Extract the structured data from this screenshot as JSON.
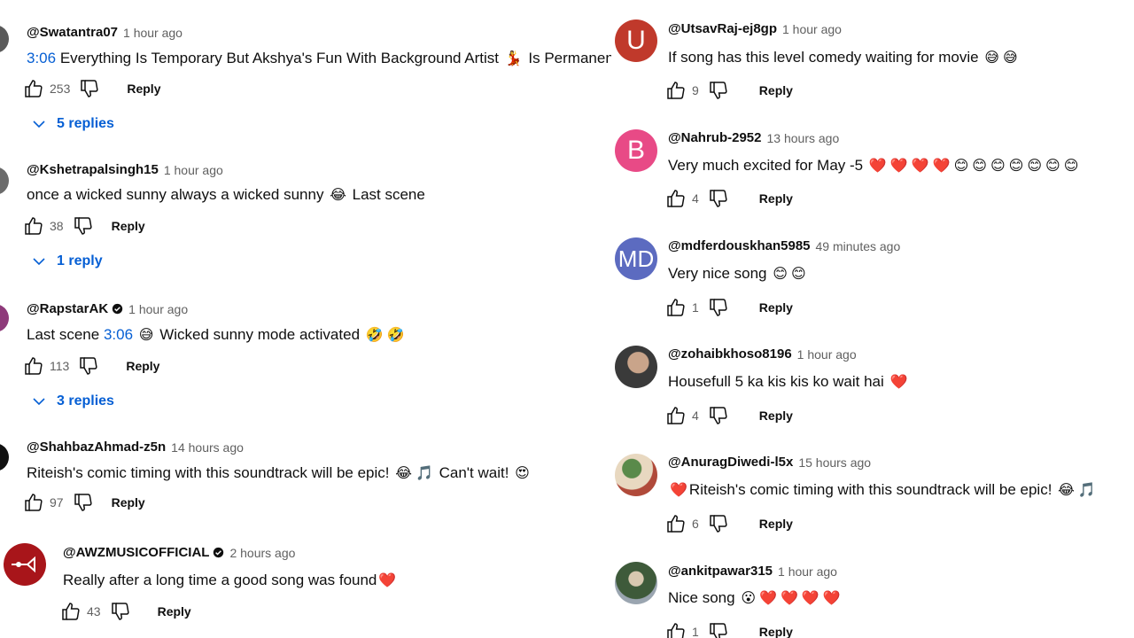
{
  "left": [
    {
      "author": "@Swatantra07",
      "time": "1 hour ago",
      "verified": false,
      "parts": [
        {
          "t": "ts",
          "v": "3:06"
        },
        {
          "t": "txt",
          "v": " Everything Is Temporary But Akshya's Fun With Background Artist "
        },
        {
          "t": "em",
          "v": "💃"
        },
        {
          "t": "txt",
          "v": " Is Permanente"
        }
      ],
      "likes": "253",
      "reply": "Reply",
      "replies": "5 replies"
    },
    {
      "author": "@Kshetrapalsingh15",
      "time": "1 hour ago",
      "verified": false,
      "parts": [
        {
          "t": "txt",
          "v": "once a wicked sunny always a wicked sunny "
        },
        {
          "t": "em",
          "v": "😂"
        },
        {
          "t": "txt",
          "v": " Last scene"
        }
      ],
      "likes": "38",
      "reply": "Reply",
      "replies": "1 reply"
    },
    {
      "author": "@RapstarAK",
      "time": "1 hour ago",
      "verified": true,
      "parts": [
        {
          "t": "txt",
          "v": "Last scene "
        },
        {
          "t": "ts",
          "v": "3:06"
        },
        {
          "t": "txt",
          "v": " "
        },
        {
          "t": "em",
          "v": "😅"
        },
        {
          "t": "txt",
          "v": "  Wicked sunny mode activated "
        },
        {
          "t": "em",
          "v": "🤣"
        },
        {
          "t": "em",
          "v": "🤣"
        }
      ],
      "likes": "113",
      "reply": "Reply",
      "replies": "3 replies"
    },
    {
      "author": "@ShahbazAhmad-z5n",
      "time": "14 hours ago",
      "verified": false,
      "parts": [
        {
          "t": "txt",
          "v": "Riteish's comic timing with this soundtrack will be epic! "
        },
        {
          "t": "em",
          "v": "😂"
        },
        {
          "t": "em",
          "v": "🎵"
        },
        {
          "t": "txt",
          "v": " Can't wait! "
        },
        {
          "t": "em",
          "v": "😍"
        }
      ],
      "likes": "97",
      "reply": "Reply",
      "replies": ""
    },
    {
      "author": "@AWZMUSICOFFICIAL",
      "time": "2 hours ago",
      "verified": true,
      "parts": [
        {
          "t": "txt",
          "v": "Really after a long time a good song was found"
        },
        {
          "t": "em",
          "v": "❤️"
        }
      ],
      "likes": "43",
      "reply": "Reply",
      "replies": ""
    }
  ],
  "right": [
    {
      "author": "@UtsavRaj-ej8gp",
      "time": "1 hour ago",
      "avatar_letter": "U",
      "avatar_color": "#c0392b",
      "parts": [
        {
          "t": "txt",
          "v": "If song has this level comedy waiting for movie "
        },
        {
          "t": "em",
          "v": "😅"
        },
        {
          "t": "em",
          "v": "😅"
        }
      ],
      "likes": "9",
      "reply": "Reply"
    },
    {
      "author": "@Nahrub-2952",
      "time": "13 hours ago",
      "avatar_letter": "B",
      "avatar_color": "#e84a86",
      "parts": [
        {
          "t": "txt",
          "v": "Very much excited for May -5 "
        },
        {
          "t": "em",
          "v": "❤️"
        },
        {
          "t": "em",
          "v": "❤️"
        },
        {
          "t": "em",
          "v": "❤️"
        },
        {
          "t": "em",
          "v": "❤️"
        },
        {
          "t": "em",
          "v": "😊"
        },
        {
          "t": "em",
          "v": "😊"
        },
        {
          "t": "em",
          "v": "😊"
        },
        {
          "t": "em",
          "v": "😊"
        },
        {
          "t": "em",
          "v": "😊"
        },
        {
          "t": "em",
          "v": "😊"
        },
        {
          "t": "em",
          "v": "😊"
        }
      ],
      "likes": "4",
      "reply": "Reply"
    },
    {
      "author": "@mdferdouskhan5985",
      "time": "49 minutes ago",
      "avatar_letter": "MD",
      "avatar_color": "#5c6bc0",
      "parts": [
        {
          "t": "txt",
          "v": "Very nice song "
        },
        {
          "t": "em",
          "v": "😊"
        },
        {
          "t": "em",
          "v": "😊"
        }
      ],
      "likes": "1",
      "reply": "Reply"
    },
    {
      "author": "@zohaibkhoso8196",
      "time": "1 hour ago",
      "avatar_letter": "",
      "avatar_color": "#4a4a4a",
      "parts": [
        {
          "t": "txt",
          "v": "Housefull 5 ka kis kis ko wait hai "
        },
        {
          "t": "em",
          "v": "❤️"
        }
      ],
      "likes": "4",
      "reply": "Reply"
    },
    {
      "author": "@AnuragDiwedi-l5x",
      "time": "15 hours ago",
      "avatar_letter": "",
      "avatar_color": "#7a6a4a",
      "parts": [
        {
          "t": "em",
          "v": "❤️"
        },
        {
          "t": "txt",
          "v": "Riteish's comic timing with this soundtrack will be epic! "
        },
        {
          "t": "em",
          "v": "😂"
        },
        {
          "t": "em",
          "v": "🎵"
        }
      ],
      "likes": "6",
      "reply": "Reply"
    },
    {
      "author": "@ankitpawar315",
      "time": "1 hour ago",
      "avatar_letter": "",
      "avatar_color": "#3e5a3a",
      "parts": [
        {
          "t": "txt",
          "v": "Nice song "
        },
        {
          "t": "em",
          "v": "😮"
        },
        {
          "t": "em",
          "v": "❤️"
        },
        {
          "t": "em",
          "v": "❤️"
        },
        {
          "t": "em",
          "v": "❤️"
        },
        {
          "t": "em",
          "v": "❤️"
        }
      ],
      "likes": "1",
      "reply": "Reply"
    }
  ]
}
